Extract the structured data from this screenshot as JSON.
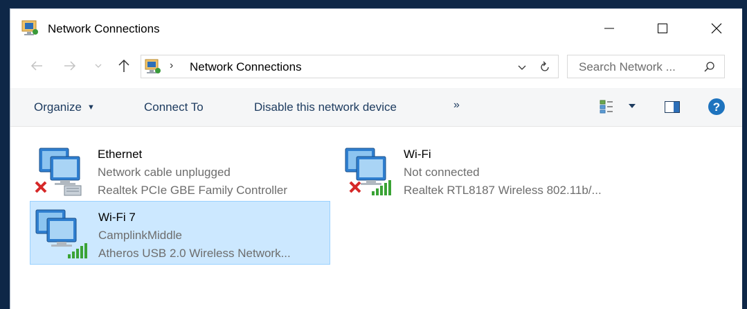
{
  "window": {
    "title": "Network Connections",
    "icon": "network-connections-icon"
  },
  "titlebar_buttons": {
    "minimize": "minimize-icon",
    "maximize": "maximize-icon",
    "close": "close-icon"
  },
  "address": {
    "separator": "›",
    "path": "Network Connections"
  },
  "search": {
    "placeholder": "Search Network ..."
  },
  "toolbar": {
    "organize": "Organize",
    "connect_to": "Connect To",
    "disable": "Disable this network device",
    "more": "»"
  },
  "connections": [
    {
      "name": "Ethernet",
      "status": "Network cable unplugged",
      "device": "Realtek PCIe GBE Family Controller",
      "type": "ethernet",
      "state": "disconnected"
    },
    {
      "name": "Wi-Fi",
      "status": "Not connected",
      "device": "Realtek RTL8187 Wireless 802.11b/...",
      "type": "wifi",
      "state": "disconnected"
    },
    {
      "name": "Wi-Fi 7",
      "status": "CamplinkMiddle",
      "device": "Atheros USB 2.0 Wireless Network...",
      "type": "wifi",
      "state": "connected",
      "selected": true
    }
  ],
  "colors": {
    "accent": "#1e3c60",
    "selection_bg": "#cce8ff",
    "selection_border": "#99d1ff",
    "secondary_text": "#6d6d6d",
    "help": "#1e73be",
    "signal": "#3aa335",
    "error": "#d62828"
  }
}
